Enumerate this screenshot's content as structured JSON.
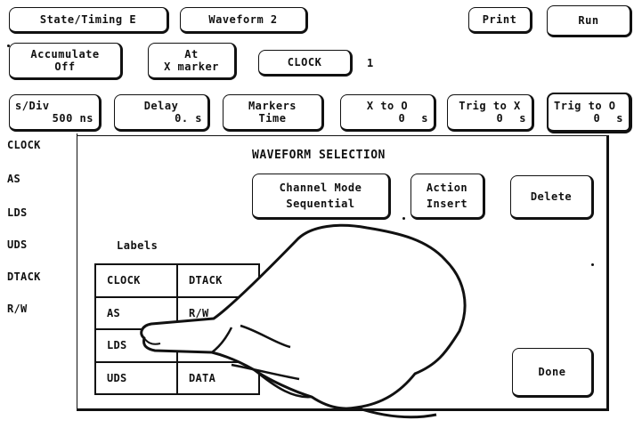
{
  "top_bar": {
    "state_timing": "State/Timing E",
    "waveform": "Waveform 2",
    "print": "Print",
    "run": "Run"
  },
  "second_row": {
    "accumulate_line1": "Accumulate",
    "accumulate_line2": "Off",
    "at_line1": "At",
    "at_line2": "X marker",
    "clock_label": "CLOCK",
    "clock_value": "1"
  },
  "third_row": {
    "sdiv_label": "s/Div",
    "sdiv_value": "500 ns",
    "delay_label": "Delay",
    "delay_value": "0. s",
    "markers_label": "Markers",
    "markers_value": "Time",
    "x_to_o_label": "X to O",
    "x_to_o_value": "0",
    "x_to_o_unit": "s",
    "trig_to_x_label": "Trig to X",
    "trig_to_x_value": "0",
    "trig_to_x_unit": "s",
    "trig_to_o_label": "Trig to O",
    "trig_to_o_value": "0",
    "trig_to_o_unit": "s"
  },
  "sidebar": {
    "items": [
      "CLOCK",
      "AS",
      "LDS",
      "UDS",
      "DTACK",
      "R/W"
    ]
  },
  "dialog": {
    "title": "WAVEFORM SELECTION",
    "channel_mode_label": "Channel Mode",
    "channel_mode_value": "Sequential",
    "action_label": "Action",
    "action_value": "Insert",
    "delete": "Delete",
    "labels_heading": "Labels",
    "done": "Done",
    "labels_grid": [
      [
        "CLOCK",
        "DTACK"
      ],
      [
        "AS",
        "R/W"
      ],
      [
        "LDS",
        ""
      ],
      [
        "UDS",
        "DATA"
      ]
    ]
  }
}
